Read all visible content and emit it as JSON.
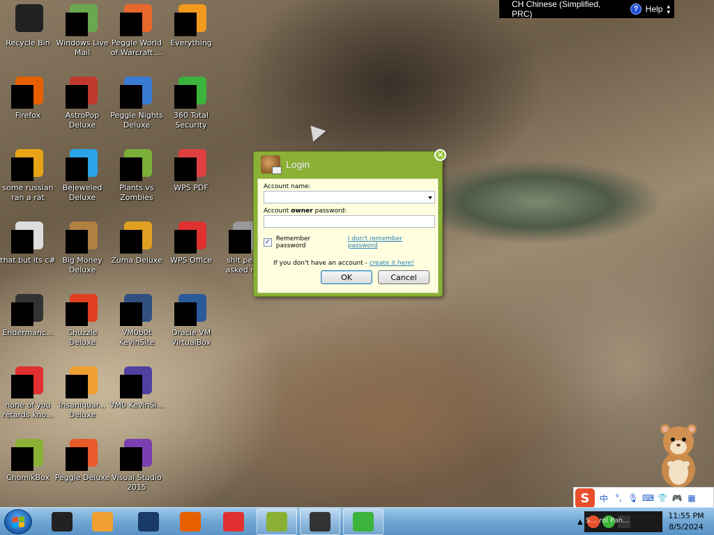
{
  "language_bar": {
    "language": "CH Chinese (Simplified, PRC)",
    "help": "Help"
  },
  "desktop_icons": [
    {
      "label": "Recycle Bin",
      "icon": "recycle-bin-icon",
      "color": "#222222"
    },
    {
      "label": "Windows Live Mail",
      "icon": "mail-icon",
      "color": "#6aa84f"
    },
    {
      "label": "Peggle World of Warcraft ...",
      "icon": "peggle-wow-icon",
      "color": "#e8672a"
    },
    {
      "label": "Everything",
      "icon": "everything-icon",
      "color": "#f29a1f"
    },
    {
      "label": "Firefox",
      "icon": "firefox-icon",
      "color": "#e66000"
    },
    {
      "label": "AstroPop Deluxe",
      "icon": "astropop-icon",
      "color": "#c0392b"
    },
    {
      "label": "Peggle Nights Deluxe",
      "icon": "peggle-nights-icon",
      "color": "#3a7bd5"
    },
    {
      "label": "360 Total Security",
      "icon": "shield-360-icon",
      "color": "#3cb43c"
    },
    {
      "label": "some russian ran a rat",
      "icon": "file-icon",
      "color": "#e8a317"
    },
    {
      "label": "Bejeweled Deluxe",
      "icon": "bejeweled-icon",
      "color": "#2aa3e8"
    },
    {
      "label": "Plants vs Zombies",
      "icon": "pvz-icon",
      "color": "#7cae3a"
    },
    {
      "label": "WPS PDF",
      "icon": "pdf-icon",
      "color": "#e04040"
    },
    {
      "label": "that but its c#",
      "icon": "file-stack-icon",
      "color": "#dddddd"
    },
    {
      "label": "Big Money Deluxe",
      "icon": "big-money-icon",
      "color": "#b08040"
    },
    {
      "label": "Zuma Deluxe",
      "icon": "zuma-icon",
      "color": "#e0a020"
    },
    {
      "label": "WPS Office",
      "icon": "wps-office-icon",
      "color": "#e03030"
    },
    {
      "label": "shit peo... asked m...",
      "icon": "folder-icon",
      "color": "#999999"
    },
    {
      "label": "Endermanc...",
      "icon": "console-icon",
      "color": "#333333"
    },
    {
      "label": "Chuzzle Deluxe",
      "icon": "chuzzle-icon",
      "color": "#e04020"
    },
    {
      "label": "VM0b0t KevinSite",
      "icon": "vm-icon",
      "color": "#305080"
    },
    {
      "label": "Oracle VM VirtualBox",
      "icon": "virtualbox-icon",
      "color": "#2a5a9a"
    },
    {
      "label": "none of you retards kno...",
      "icon": "browser-icon",
      "color": "#e03030"
    },
    {
      "label": "Insaniquar... Deluxe",
      "icon": "insaniquarium-icon",
      "color": "#f0a030"
    },
    {
      "label": "VM0 KevinSi...",
      "icon": "vm-icon",
      "color": "#5040a0"
    },
    {
      "label": "ChomikBox",
      "icon": "chomikbox-icon",
      "color": "#8bb036"
    },
    {
      "label": "Peggle Deluxe",
      "icon": "peggle-icon",
      "color": "#e85a2a"
    },
    {
      "label": "Visual Studio 2015",
      "icon": "visual-studio-icon",
      "color": "#7a3fb0"
    }
  ],
  "login_dialog": {
    "title": "Login",
    "account_name_label": "Account name:",
    "account_name_value": "",
    "password_label_pre": "Account ",
    "password_label_bold": "owner",
    "password_label_post": " password:",
    "password_value": "",
    "remember_label": "Remember password",
    "remember_checked": true,
    "forgot_link": "I don't remember password",
    "signup_text": "If you don't have an account - ",
    "signup_link": "create it here!",
    "ok_label": "OK",
    "cancel_label": "Cancel"
  },
  "ime_bar": {
    "logo": "S",
    "mode": "中"
  },
  "taskbar": {
    "apps": [
      {
        "icon": "file-manager-icon",
        "color": "#222222"
      },
      {
        "icon": "media-player-icon",
        "color": "#f0a030"
      },
      {
        "icon": "steam-icon",
        "color": "#1a3a6a"
      },
      {
        "icon": "firefox-icon",
        "color": "#e66000"
      },
      {
        "icon": "wps-office-icon",
        "color": "#e03030"
      },
      {
        "icon": "chomikbox-icon",
        "color": "#8bb036"
      },
      {
        "icon": "terminal-icon",
        "color": "#333333"
      },
      {
        "icon": "360-security-icon",
        "color": "#3cb43c"
      }
    ],
    "tray_text": "S... rol Pan...",
    "time": "11:55 PM",
    "date": "8/5/2024"
  }
}
